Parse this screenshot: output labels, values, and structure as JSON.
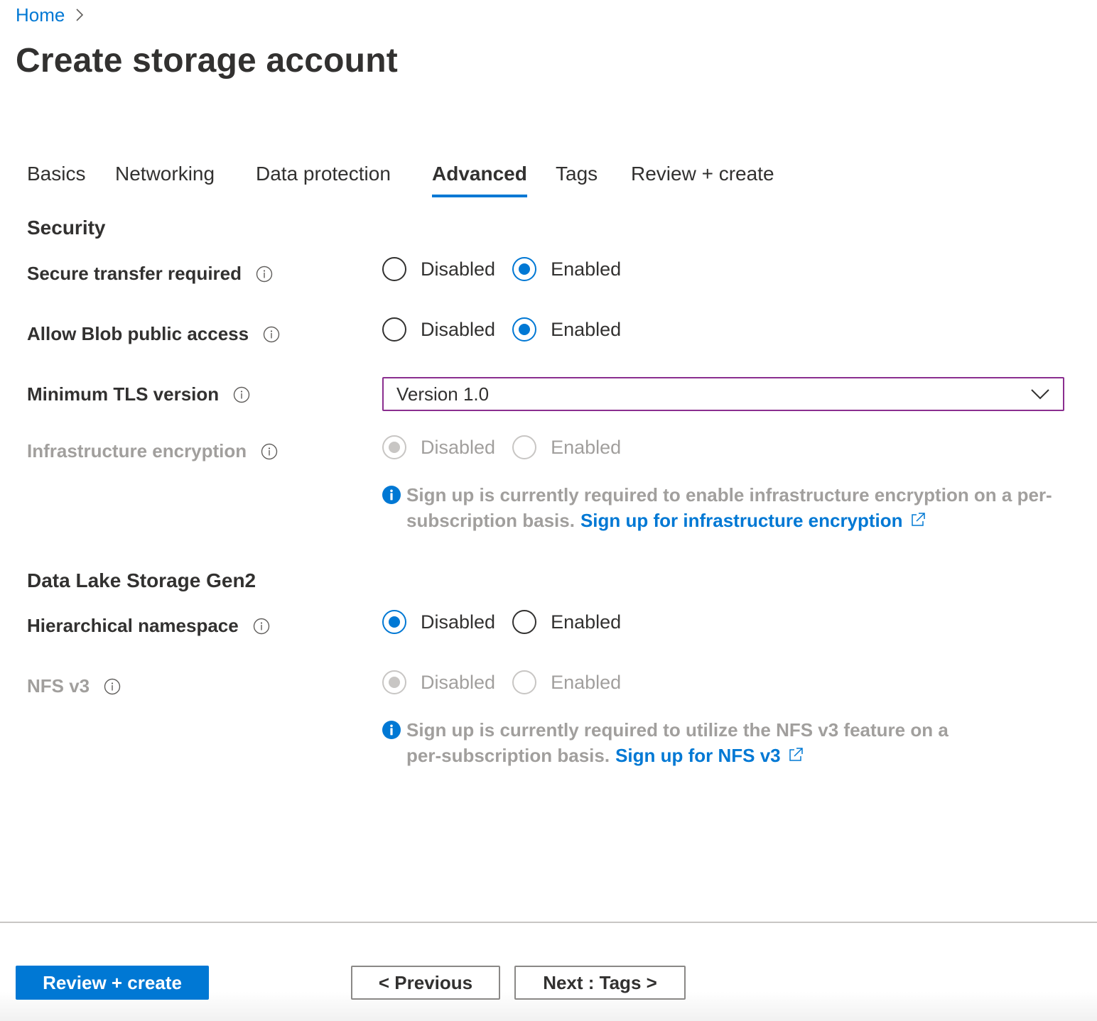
{
  "breadcrumb": {
    "home_label": "Home"
  },
  "page": {
    "title": "Create storage account"
  },
  "tabs": [
    {
      "label": "Basics",
      "active": false
    },
    {
      "label": "Networking",
      "active": false
    },
    {
      "label": "Data protection",
      "active": false
    },
    {
      "label": "Advanced",
      "active": true
    },
    {
      "label": "Tags",
      "active": false
    },
    {
      "label": "Review + create",
      "active": false
    }
  ],
  "security": {
    "title": "Security",
    "secure_transfer": {
      "label": "Secure transfer required",
      "options": [
        "Disabled",
        "Enabled"
      ],
      "selected": "Enabled",
      "disabled": false
    },
    "blob_public_access": {
      "label": "Allow Blob public access",
      "options": [
        "Disabled",
        "Enabled"
      ],
      "selected": "Enabled",
      "disabled": false
    },
    "min_tls": {
      "label": "Minimum TLS version",
      "value": "Version 1.0"
    },
    "infrastructure_encryption": {
      "label": "Infrastructure encryption",
      "options": [
        "Disabled",
        "Enabled"
      ],
      "selected": "Disabled",
      "disabled": true,
      "note": "Sign up is currently required to enable infrastructure encryption on a per-subscription basis.",
      "link": "Sign up for infrastructure encryption"
    }
  },
  "datalake": {
    "title": "Data Lake Storage Gen2",
    "hierarchical_namespace": {
      "label": "Hierarchical namespace",
      "options": [
        "Disabled",
        "Enabled"
      ],
      "selected": "Disabled",
      "disabled": false
    },
    "nfs_v3": {
      "label": "NFS v3",
      "options": [
        "Disabled",
        "Enabled"
      ],
      "selected": "Disabled",
      "disabled": true,
      "note": "Sign up is currently required to utilize the NFS v3 feature on a per-subscription basis.",
      "link": "Sign up for NFS v3"
    }
  },
  "footer": {
    "review_create_label": "Review + create",
    "previous_label": "< Previous",
    "next_label": "Next : Tags >"
  },
  "colors": {
    "accent": "#0078d4",
    "text": "#323130",
    "disabled_text": "#a19f9d",
    "dropdown_focus_border": "#8a2e8f"
  },
  "icons": {
    "breadcrumb_separator": "chevron-right-icon",
    "field_info": "info-outline-icon",
    "note_info": "info-filled-icon",
    "external_link": "external-link-icon",
    "dropdown": "chevron-down-icon"
  }
}
